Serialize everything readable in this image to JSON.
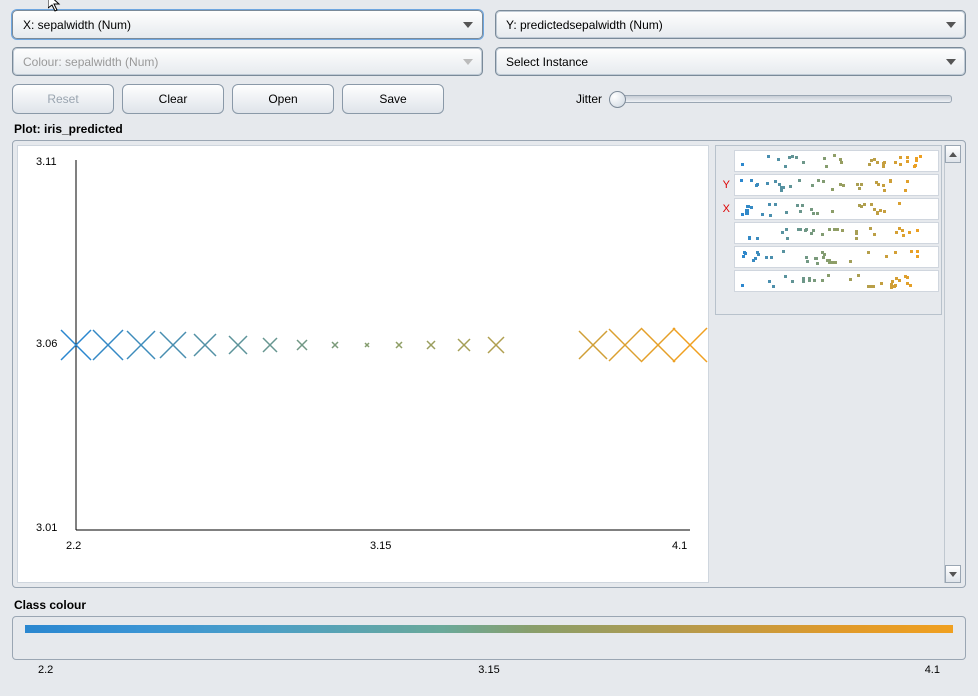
{
  "dropdowns": {
    "x": "X: sepalwidth (Num)",
    "y": "Y: predictedsepalwidth (Num)",
    "colour": "Colour: sepalwidth (Num)",
    "instance": "Select Instance"
  },
  "buttons": {
    "reset": "Reset",
    "clear": "Clear",
    "open": "Open",
    "save": "Save"
  },
  "jitter_label": "Jitter",
  "plot_title": "Plot: iris_predicted",
  "mini_labels": {
    "y": "Y",
    "x": "X"
  },
  "axes": {
    "ymax": "3.11",
    "ymid": "3.06",
    "ymin": "3.01",
    "xmin": "2.2",
    "xmid": "3.15",
    "xmax": "4.1"
  },
  "class_colour_label": "Class colour",
  "class_colour_scale": {
    "min": "2.2",
    "mid": "3.15",
    "max": "4.1"
  },
  "chart_data": {
    "type": "scatter",
    "title": "iris_predicted",
    "xlabel": "sepalwidth",
    "ylabel": "predictedsepalwidth",
    "xlim": [
      2.2,
      4.1
    ],
    "ylim": [
      3.01,
      3.11
    ],
    "colour_by": "sepalwidth",
    "colour_scale": [
      2.2,
      4.1
    ],
    "points": [
      {
        "x": 2.2,
        "y": 3.06,
        "c": 2.2,
        "size": 30
      },
      {
        "x": 2.3,
        "y": 3.06,
        "c": 2.3,
        "size": 30
      },
      {
        "x": 2.4,
        "y": 3.06,
        "c": 2.4,
        "size": 28
      },
      {
        "x": 2.5,
        "y": 3.06,
        "c": 2.5,
        "size": 26
      },
      {
        "x": 2.6,
        "y": 3.06,
        "c": 2.6,
        "size": 22
      },
      {
        "x": 2.7,
        "y": 3.06,
        "c": 2.7,
        "size": 18
      },
      {
        "x": 2.8,
        "y": 3.06,
        "c": 2.8,
        "size": 14
      },
      {
        "x": 2.9,
        "y": 3.06,
        "c": 2.9,
        "size": 10
      },
      {
        "x": 3.0,
        "y": 3.06,
        "c": 3.0,
        "size": 6
      },
      {
        "x": 3.1,
        "y": 3.06,
        "c": 3.1,
        "size": 4
      },
      {
        "x": 3.2,
        "y": 3.06,
        "c": 3.2,
        "size": 6
      },
      {
        "x": 3.3,
        "y": 3.06,
        "c": 3.3,
        "size": 8
      },
      {
        "x": 3.4,
        "y": 3.06,
        "c": 3.4,
        "size": 12
      },
      {
        "x": 3.5,
        "y": 3.06,
        "c": 3.5,
        "size": 16
      },
      {
        "x": 3.8,
        "y": 3.06,
        "c": 3.8,
        "size": 28
      },
      {
        "x": 3.9,
        "y": 3.06,
        "c": 3.9,
        "size": 32
      },
      {
        "x": 4.0,
        "y": 3.06,
        "c": 4.0,
        "size": 34
      },
      {
        "x": 4.1,
        "y": 3.06,
        "c": 4.1,
        "size": 34
      }
    ]
  }
}
